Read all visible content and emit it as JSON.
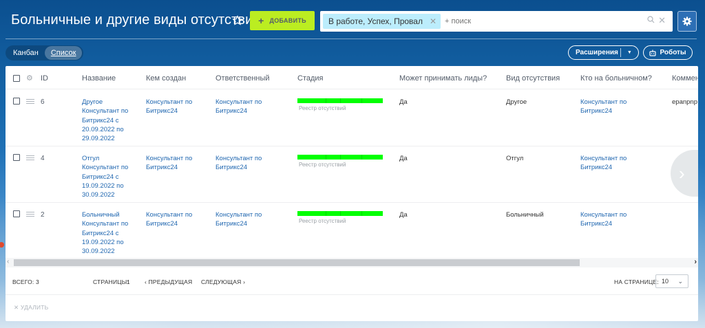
{
  "header": {
    "title": "Больничные и другие виды отсутствия",
    "add_label": "ДОБАВИТЬ",
    "filter_chip": "В работе, Успех, Провал",
    "search_placeholder": "+ поиск"
  },
  "views": {
    "kanban": "Канбан",
    "list": "Список"
  },
  "toolbar": {
    "extensions": "Расширения",
    "robots": "Роботы"
  },
  "columns": [
    "ID",
    "Название",
    "Кем создан",
    "Ответственный",
    "Стадия",
    "Может принимать лиды?",
    "Вид отсутствия",
    "Кто на больничном?",
    "Коммен"
  ],
  "rows": [
    {
      "id": "6",
      "name": "Другое Консультант по Битрикс24 с 20.09.2022 по 29.09.2022",
      "created_by": "Консультант по Битрикс24",
      "responsible": "Консультант по Битрикс24",
      "stage": "Реестр отсутствий",
      "can_accept_leads": "Да",
      "absence_type": "Другое",
      "who_is_sick": "Консультант по Битрикс24",
      "comment": "epanpnp"
    },
    {
      "id": "4",
      "name": "Отгул Консультант по Битрикс24 с 19.09.2022 по 30.09.2022",
      "created_by": "Консультант по Битрикс24",
      "responsible": "Консультант по Битрикс24",
      "stage": "Реестр отсутствий",
      "can_accept_leads": "Да",
      "absence_type": "Отгул",
      "who_is_sick": "Консультант по Битрикс24",
      "comment": ""
    },
    {
      "id": "2",
      "name": "Больничный Консультант по Битрикс24 с 19.09.2022 по 30.09.2022",
      "created_by": "Консультант по Битрикс24",
      "responsible": "Консультант по Битрикс24",
      "stage": "Реестр отсутствий",
      "can_accept_leads": "Да",
      "absence_type": "Больничный",
      "who_is_sick": "Консультант по Битрикс24",
      "comment": ""
    }
  ],
  "footer": {
    "total": "ВСЕГО: 3",
    "pages": "СТРАНИЦЫ:",
    "page_number": "1",
    "prev": "ПРЕДЫДУЩАЯ",
    "next": "СЛЕДУЮЩАЯ",
    "per_page_label": "НА СТРАНИЦЕ:",
    "per_page_value": "10",
    "delete": "УДАЛИТЬ"
  },
  "colors": {
    "accent_green": "#bbed21",
    "stage_bar": "#00ff00",
    "link": "#2067b0"
  },
  "icons": [
    "star-icon",
    "plus-icon",
    "search-icon",
    "close-icon",
    "gear-icon",
    "robot-icon",
    "drag-handle-icon",
    "chevron-right-icon",
    "chevron-left-icon",
    "chevron-down-icon"
  ]
}
